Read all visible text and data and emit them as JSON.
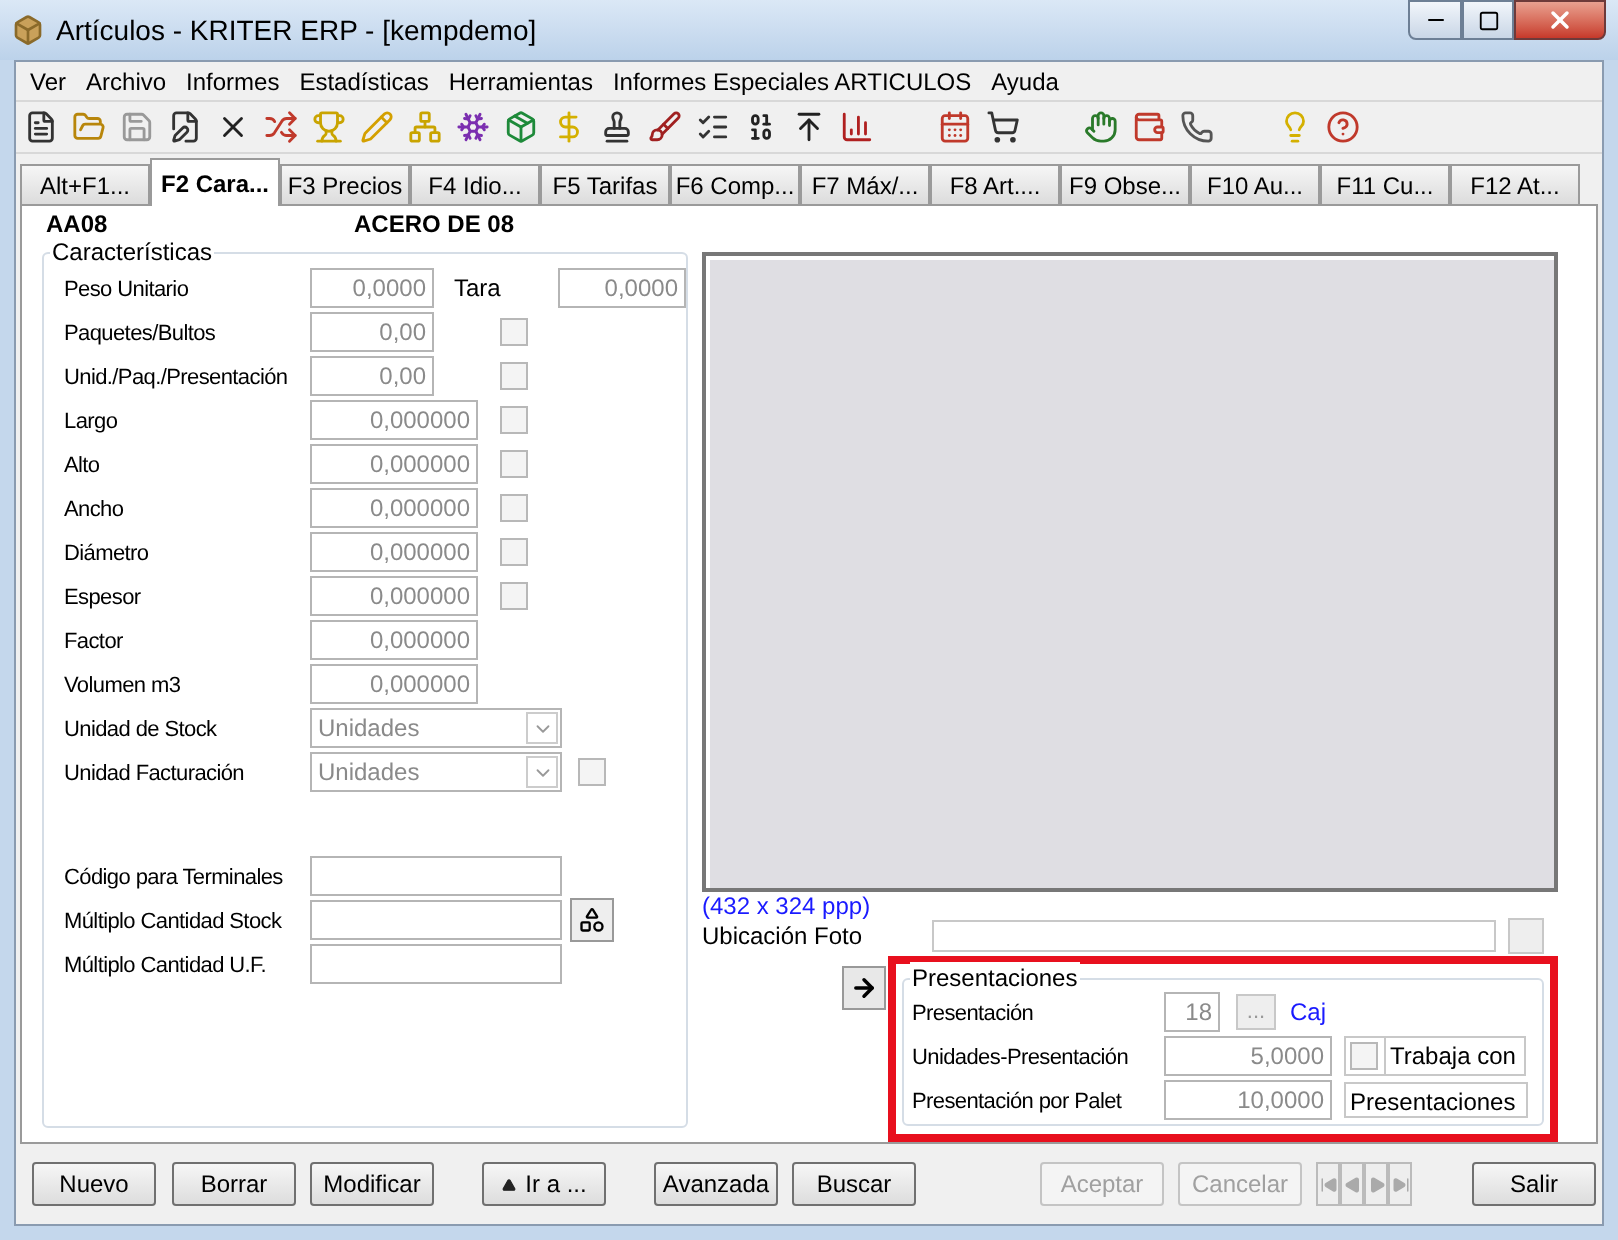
{
  "window": {
    "title": "Artículos - KRITER ERP - [kempdemo]"
  },
  "menu": [
    "Ver",
    "Archivo",
    "Informes",
    "Estadísticas",
    "Herramientas",
    "Informes Especiales ARTICULOS",
    "Ayuda"
  ],
  "tabs": [
    {
      "label": "Alt+F1...",
      "selected": false
    },
    {
      "label": "F2 Cara...",
      "selected": true
    },
    {
      "label": "F3 Precios",
      "selected": false
    },
    {
      "label": "F4 Idio...",
      "selected": false
    },
    {
      "label": "F5 Tarifas",
      "selected": false
    },
    {
      "label": "F6 Comp...",
      "selected": false
    },
    {
      "label": "F7 Máx/...",
      "selected": false
    },
    {
      "label": "F8 Art....",
      "selected": false
    },
    {
      "label": "F9 Obse...",
      "selected": false
    },
    {
      "label": "F10 Au...",
      "selected": false
    },
    {
      "label": "F11 Cu...",
      "selected": false
    },
    {
      "label": "F12 At...",
      "selected": false
    }
  ],
  "header": {
    "code": "AA08",
    "name": "ACERO DE 08"
  },
  "characteristics": {
    "legend": "Características",
    "rows": [
      {
        "kind": "number",
        "label": "Peso Unitario",
        "value": "0,0000",
        "extra_label": "Tara",
        "extra_value": "0,0000"
      },
      {
        "kind": "short",
        "label": "Paquetes/Bultos",
        "value": "0,00",
        "checked": false
      },
      {
        "kind": "short",
        "label": "Unid./Paq./Presentación",
        "value": "0,00",
        "checked": false
      },
      {
        "kind": "number",
        "label": "Largo",
        "value": "0,000000",
        "checked": false
      },
      {
        "kind": "number",
        "label": "Alto",
        "value": "0,000000",
        "checked": false
      },
      {
        "kind": "number",
        "label": "Ancho",
        "value": "0,000000",
        "checked": false
      },
      {
        "kind": "number",
        "label": "Diámetro",
        "value": "0,000000",
        "checked": false
      },
      {
        "kind": "number",
        "label": "Espesor",
        "value": "0,000000",
        "checked": false
      },
      {
        "kind": "number",
        "label": "Factor",
        "value": "0,000000"
      },
      {
        "kind": "number",
        "label": "Volumen m3",
        "value": "0,000000"
      },
      {
        "kind": "select",
        "label": "Unidad de Stock",
        "value": "Unidades"
      },
      {
        "kind": "select",
        "label": "Unidad Facturación",
        "value": "Unidades",
        "checked": false
      }
    ]
  },
  "codes": [
    {
      "label": "Código para Terminales"
    },
    {
      "label": "Múltiplo Cantidad Stock",
      "has_button": true
    },
    {
      "label": "Múltiplo Cantidad U.F."
    }
  ],
  "photo": {
    "resolution": "(432 x 324 ppp)",
    "location_label": "Ubicación Foto"
  },
  "presentaciones": {
    "legend": "Presentaciones",
    "presentacion_label": "Presentación",
    "presentacion_value": "18",
    "presentacion_button": "...",
    "presentacion_unit": "Caj",
    "unidades_label": "Unidades-Presentación",
    "unidades_value": "5,0000",
    "trabaja_checked": false,
    "trabaja_label": "Trabaja con",
    "palet_label": "Presentación por Palet",
    "palet_value": "10,0000",
    "presentaciones_text": "Presentaciones"
  },
  "buttons": [
    {
      "label": "Nuevo",
      "disabled": false
    },
    {
      "label": "Borrar",
      "disabled": false
    },
    {
      "label": "Modificar",
      "disabled": false
    },
    {
      "label": "Ir a ...",
      "disabled": false,
      "kind": "goto"
    },
    {
      "label": "Avanzada",
      "disabled": false
    },
    {
      "label": "Buscar",
      "disabled": false
    },
    {
      "label": "Aceptar",
      "disabled": true
    },
    {
      "label": "Cancelar",
      "disabled": true
    },
    {
      "kind": "nav",
      "disabled": true
    },
    {
      "label": "Salir",
      "disabled": false
    }
  ]
}
